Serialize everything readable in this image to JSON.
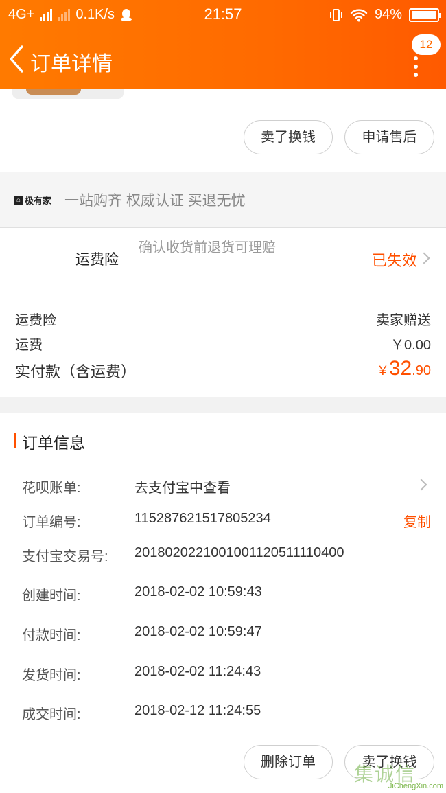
{
  "status_bar": {
    "network": "4G+",
    "speed": "0.1K/s",
    "time": "21:57",
    "battery": "94%"
  },
  "nav": {
    "title": "订单详情",
    "badge_count": "12"
  },
  "actions_top": {
    "sell_label": "卖了换钱",
    "after_sale_label": "申请售后"
  },
  "brand": {
    "logo_text": "极有家",
    "slogan": "一站购齐 权威认证 买退无忧"
  },
  "insurance": {
    "title": "运费险",
    "description": "确认收货前退货可理赔",
    "status": "已失效"
  },
  "fees": [
    {
      "label": "运费险",
      "value": "卖家赠送"
    },
    {
      "label": "运费",
      "value": "￥0.00"
    }
  ],
  "paid": {
    "label": "实付款（含运费）",
    "currency": "￥",
    "integer": "32",
    "decimal": ".90"
  },
  "order_info": {
    "title": "订单信息",
    "rows": [
      {
        "label": "花呗账单:",
        "value": "去支付宝中查看"
      },
      {
        "label": "订单编号:",
        "value": "115287621517805234"
      },
      {
        "label": "支付宝交易号:",
        "value": "2018020221001001120511110400"
      },
      {
        "label": "创建时间:",
        "value": "2018-02-02 10:59:43"
      },
      {
        "label": "付款时间:",
        "value": "2018-02-02 10:59:47"
      },
      {
        "label": "发货时间:",
        "value": "2018-02-02 11:24:43"
      },
      {
        "label": "成交时间:",
        "value": "2018-02-12 11:24:55"
      }
    ],
    "copy_label": "复制"
  },
  "actions_bottom": {
    "delete_label": "删除订单",
    "sell_label": "卖了换钱"
  },
  "watermark": {
    "logo": "集诚信",
    "url": "JiChengXin.com"
  },
  "colors": {
    "accent": "#ff5000",
    "header": "#ff6a00"
  }
}
